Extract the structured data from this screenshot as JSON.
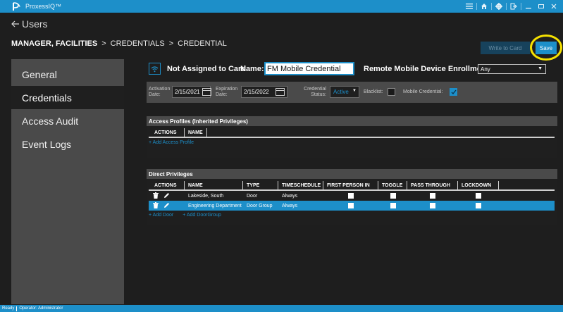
{
  "app": {
    "title": "ProxessIQ™"
  },
  "window_controls": [
    "menu-icon",
    "home-icon",
    "settings-icon",
    "logout-icon",
    "minimize-icon",
    "maximize-icon",
    "close-icon"
  ],
  "header": {
    "back_label": "Users",
    "breadcrumb": {
      "user": "MANAGER, FACILITIES",
      "sep": ">",
      "credentials": "CREDENTIALS",
      "credential": "CREDENTIAL"
    },
    "write_to_card_label": "Write to Card",
    "save_label": "Save"
  },
  "sidebar": {
    "items": [
      {
        "label": "General",
        "active": false
      },
      {
        "label": "Credentials",
        "active": true
      },
      {
        "label": "Access Audit",
        "active": false
      },
      {
        "label": "Event Logs",
        "active": false
      }
    ]
  },
  "credential": {
    "card_status": "Not Assigned to Card",
    "name_label": "Name:",
    "name_value": "FM Mobile Credential",
    "remote_label": "Remote Mobile Device Enrollment",
    "remote_value": "Any",
    "activation_label": "Activation Date:",
    "activation_value": "2/15/2021",
    "expiration_label": "Expiration Date:",
    "expiration_value": "2/15/2022",
    "status_label": "Credential Status:",
    "status_value": "Active",
    "blacklist_label": "Blacklist:",
    "blacklist_checked": false,
    "mobile_label": "Mobile Credential:",
    "mobile_checked": true
  },
  "access_profiles": {
    "title": "Access Profiles (Inherited Privileges)",
    "columns": [
      "ACTIONS",
      "NAME"
    ],
    "add_label": "+ Add Access Profile"
  },
  "direct_privileges": {
    "title": "Direct Privileges",
    "columns": [
      "ACTIONS",
      "NAME",
      "TYPE",
      "TIMESCHEDULE",
      "FIRST PERSON IN",
      "TOGGLE",
      "PASS THROUGH",
      "LOCKDOWN"
    ],
    "rows": [
      {
        "name": "Lakeside, South",
        "type": "Door",
        "schedule": "Always",
        "first_person_in": false,
        "toggle": false,
        "pass_through": false,
        "lockdown": false,
        "selected": false
      },
      {
        "name": "Engineering Department",
        "type": "Door Group",
        "schedule": "Always",
        "first_person_in": false,
        "toggle": false,
        "pass_through": false,
        "lockdown": false,
        "selected": true
      }
    ],
    "add_door_label": "+ Add Door",
    "add_doorgroup_label": "+ Add DoorGroup"
  },
  "status_bar": {
    "status": "Ready",
    "operator": "Operator: Administrator"
  },
  "colors": {
    "accent": "#1d8fc9",
    "background": "#1e1e1e",
    "panel": "#4a4a4a",
    "highlight": "#f5e100"
  }
}
